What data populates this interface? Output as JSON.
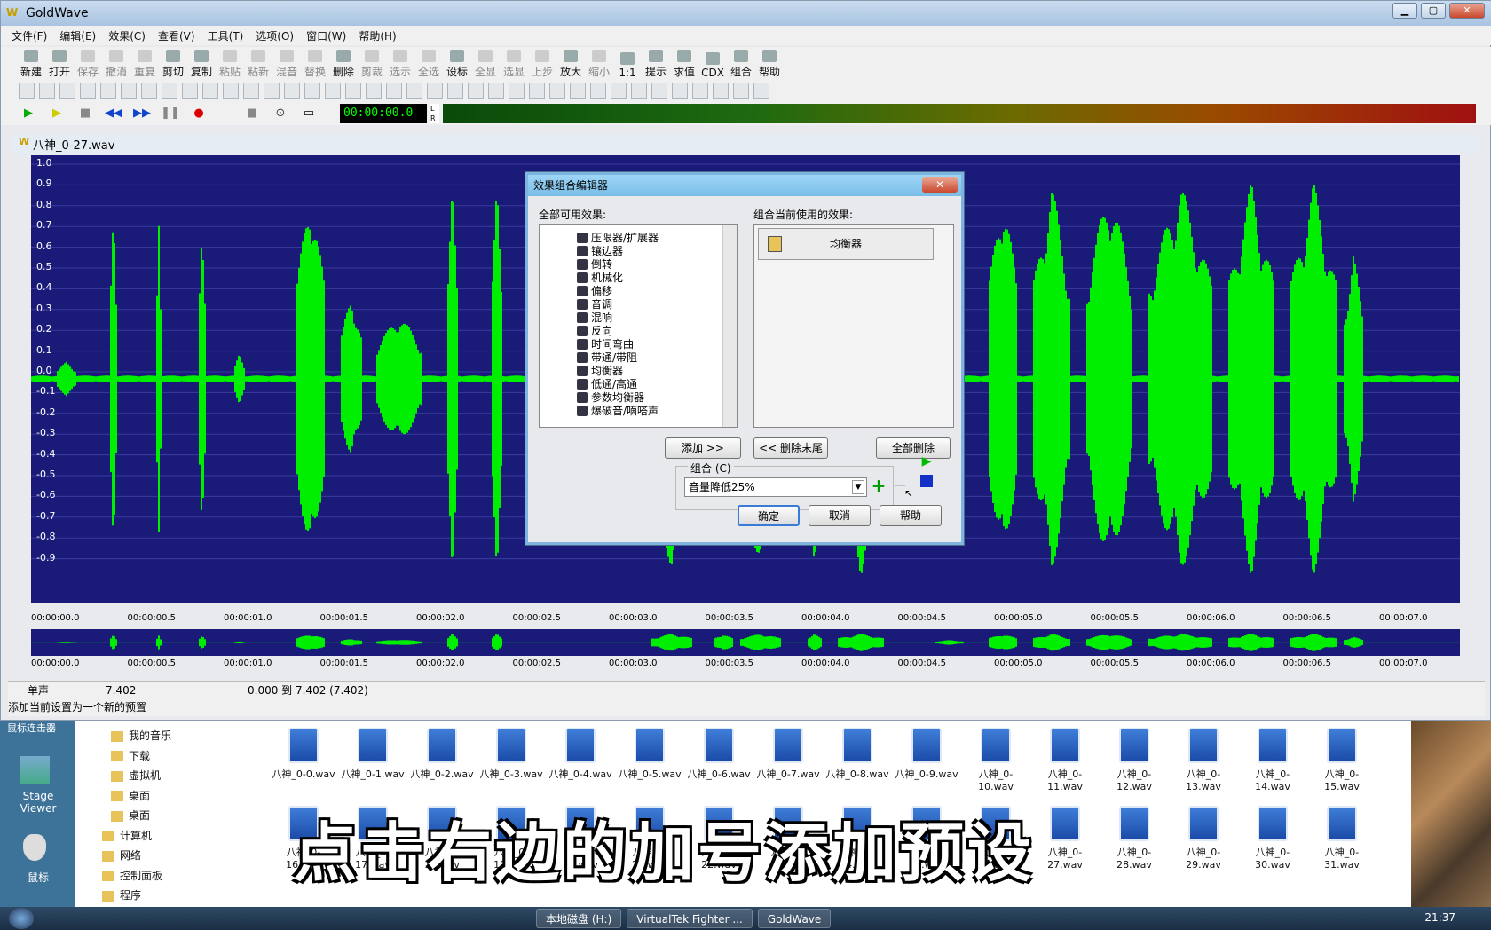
{
  "app": {
    "title": "GoldWave",
    "win_min": "▁",
    "win_max": "▢",
    "win_close": "✕"
  },
  "menu": [
    "文件(F)",
    "编辑(E)",
    "效果(C)",
    "查看(V)",
    "工具(T)",
    "选项(O)",
    "窗口(W)",
    "帮助(H)"
  ],
  "toolbar": [
    {
      "label": "新建",
      "enabled": true
    },
    {
      "label": "打开",
      "enabled": true
    },
    {
      "label": "保存",
      "enabled": false
    },
    {
      "label": "撤消",
      "enabled": false
    },
    {
      "label": "重复",
      "enabled": false
    },
    {
      "label": "剪切",
      "enabled": true
    },
    {
      "label": "复制",
      "enabled": true
    },
    {
      "label": "粘贴",
      "enabled": false
    },
    {
      "label": "粘新",
      "enabled": false
    },
    {
      "label": "混音",
      "enabled": false
    },
    {
      "label": "替换",
      "enabled": false
    },
    {
      "label": "删除",
      "enabled": true
    },
    {
      "label": "剪裁",
      "enabled": false
    },
    {
      "label": "选示",
      "enabled": false
    },
    {
      "label": "全选",
      "enabled": false
    },
    {
      "label": "设标",
      "enabled": true
    },
    {
      "label": "全显",
      "enabled": false
    },
    {
      "label": "选显",
      "enabled": false
    },
    {
      "label": "上步",
      "enabled": false
    },
    {
      "label": "放大",
      "enabled": true
    },
    {
      "label": "缩小",
      "enabled": false
    },
    {
      "label": "1:1",
      "enabled": true
    },
    {
      "label": "提示",
      "enabled": true
    },
    {
      "label": "求值",
      "enabled": true
    },
    {
      "label": "CDX",
      "enabled": true
    },
    {
      "label": "组合",
      "enabled": true
    },
    {
      "label": "帮助",
      "enabled": true
    }
  ],
  "transport": {
    "time": "00:00:00.0",
    "meter_label": "L R"
  },
  "document": {
    "title": "八神_0-27.wav"
  },
  "waveform": {
    "y_ticks": [
      "1.0",
      "0.9",
      "0.8",
      "0.7",
      "0.6",
      "0.5",
      "0.4",
      "0.3",
      "0.2",
      "0.1",
      "0.0",
      "-0.1",
      "-0.2",
      "-0.3",
      "-0.4",
      "-0.5",
      "-0.6",
      "-0.7",
      "-0.8",
      "-0.9"
    ],
    "time_ticks": [
      "00:00:00.0",
      "00:00:00.5",
      "00:00:01.0",
      "00:00:01.5",
      "00:00:02.0",
      "00:00:02.5",
      "00:00:03.0",
      "00:00:03.5",
      "00:00:04.0",
      "00:00:04.5",
      "00:00:05.0",
      "00:00:05.5",
      "00:00:06.0",
      "00:00:06.5",
      "00:00:07.0"
    ],
    "wave_color": "#00ee00",
    "bg_color": "#1a1a78"
  },
  "status": {
    "channel": "单声",
    "length": "7.402",
    "selection": "0.000 到 7.402 (7.402)",
    "hint": "添加当前设置为一个新的预置"
  },
  "dialog": {
    "title": "效果组合编辑器",
    "close": "✕",
    "available_label": "全部可用效果:",
    "current_label": "组合当前使用的效果:",
    "available": [
      "压限器/扩展器",
      "镶边器",
      "倒转",
      "机械化",
      "偏移",
      "音调",
      "混响",
      "反向",
      "时间弯曲",
      "带通/带阻",
      "均衡器",
      "低通/高通",
      "参数均衡器",
      "爆破音/嘀嗒声"
    ],
    "current": [
      "均衡器"
    ],
    "add_button": "添加 >>",
    "remove_last_button": "<< 删除末尾",
    "remove_all_button": "全部删除",
    "preset_group_label": "组合 (C)",
    "preset_value": "音量降低25%",
    "add_preset": "+",
    "remove_preset": "—",
    "ok": "确定",
    "cancel": "取消",
    "help": "帮助"
  },
  "desktop": {
    "left_icons": [
      {
        "label": "Stage Viewer"
      },
      {
        "label": "鼠标"
      }
    ],
    "left_header": "鼠标连击器",
    "tree": [
      "我的音乐",
      "下载",
      "虚拟机",
      "桌面",
      "桌面",
      "计算机",
      "网络",
      "控制面板",
      "程序"
    ],
    "files": [
      "八神_0-0.wav",
      "八神_0-1.wav",
      "八神_0-2.wav",
      "八神_0-3.wav",
      "八神_0-4.wav",
      "八神_0-5.wav",
      "八神_0-6.wav",
      "八神_0-7.wav",
      "八神_0-8.wav",
      "八神_0-9.wav",
      "八神_0-10.wav",
      "八神_0-11.wav",
      "八神_0-12.wav",
      "八神_0-13.wav",
      "八神_0-14.wav",
      "八神_0-15.wav"
    ],
    "files_row2": [
      "八神_0-16.wav",
      "八神_0-17.wav",
      "八神_0-18.wav",
      "八神_0-19.wav",
      "八神_0-20.wav",
      "八神_0-21.wav",
      "八神_0-22.wav",
      "八神_0-23.wav",
      "八神_0-24.wav",
      "八神_0-25.wav",
      "八神_0-26.wav",
      "八神_0-27.wav",
      "八神_0-28.wav",
      "八神_0-29.wav",
      "八神_0-30.wav",
      "八神_0-31.wav"
    ],
    "caption": "点击右边的加号添加预设"
  },
  "taskbar": {
    "tasks": [
      "本地磁盘 (H:)",
      "VirtualTek Fighter ...",
      "GoldWave"
    ],
    "clock": "21:37"
  }
}
